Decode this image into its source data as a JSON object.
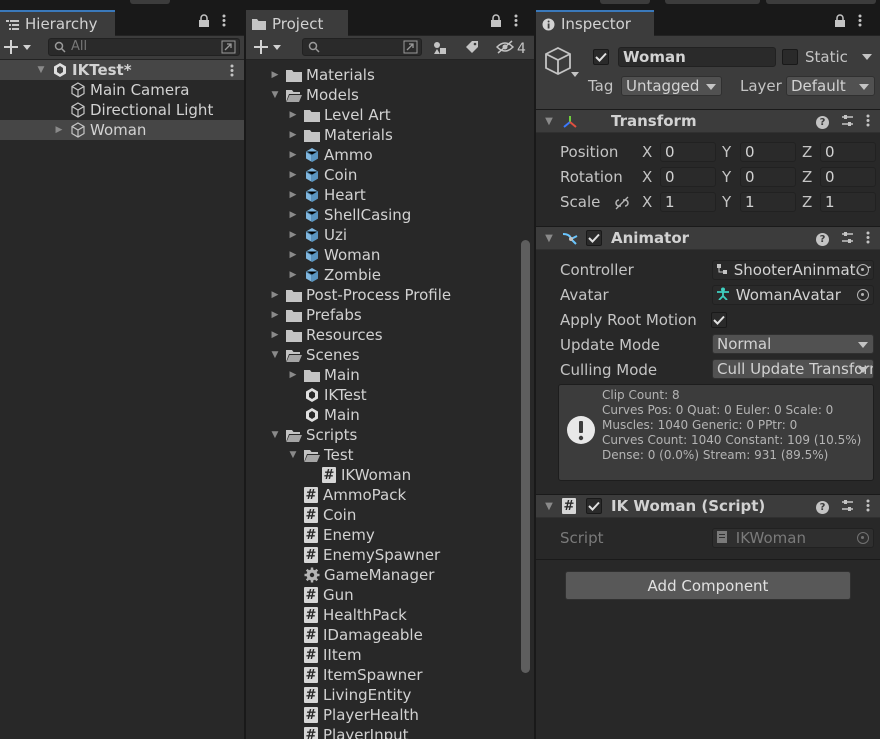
{
  "hierarchy": {
    "tab_label": "Hierarchy",
    "search_placeholder": "All",
    "scene_name": "IKTest*",
    "items": [
      {
        "label": "Main Camera"
      },
      {
        "label": "Directional Light"
      },
      {
        "label": "Woman"
      }
    ]
  },
  "project": {
    "tab_label": "Project",
    "hidden_count": "4",
    "tree": [
      {
        "label": "Materials",
        "kind": "folder"
      },
      {
        "label": "Models",
        "kind": "folder-open"
      },
      {
        "label": "Level Art",
        "kind": "folder"
      },
      {
        "label": "Materials",
        "kind": "folder"
      },
      {
        "label": "Ammo",
        "kind": "model"
      },
      {
        "label": "Coin",
        "kind": "model"
      },
      {
        "label": "Heart",
        "kind": "model"
      },
      {
        "label": "ShellCasing",
        "kind": "model"
      },
      {
        "label": "Uzi",
        "kind": "model"
      },
      {
        "label": "Woman",
        "kind": "model"
      },
      {
        "label": "Zombie",
        "kind": "model"
      },
      {
        "label": "Post-Process Profile",
        "kind": "folder"
      },
      {
        "label": "Prefabs",
        "kind": "folder"
      },
      {
        "label": "Resources",
        "kind": "folder"
      },
      {
        "label": "Scenes",
        "kind": "folder-open"
      },
      {
        "label": "Main",
        "kind": "folder"
      },
      {
        "label": "IKTest",
        "kind": "scene"
      },
      {
        "label": "Main",
        "kind": "scene"
      },
      {
        "label": "Scripts",
        "kind": "folder-open"
      },
      {
        "label": "Test",
        "kind": "folder-open"
      },
      {
        "label": "IKWoman",
        "kind": "script"
      },
      {
        "label": "AmmoPack",
        "kind": "script"
      },
      {
        "label": "Coin",
        "kind": "script"
      },
      {
        "label": "Enemy",
        "kind": "script"
      },
      {
        "label": "EnemySpawner",
        "kind": "script"
      },
      {
        "label": "GameManager",
        "kind": "gear"
      },
      {
        "label": "Gun",
        "kind": "script"
      },
      {
        "label": "HealthPack",
        "kind": "script"
      },
      {
        "label": "IDamageable",
        "kind": "script"
      },
      {
        "label": "IItem",
        "kind": "script"
      },
      {
        "label": "ItemSpawner",
        "kind": "script"
      },
      {
        "label": "LivingEntity",
        "kind": "script"
      },
      {
        "label": "PlayerHealth",
        "kind": "script"
      },
      {
        "label": "PlayerInput",
        "kind": "script"
      }
    ]
  },
  "inspector": {
    "tab_label": "Inspector",
    "object_name": "Woman",
    "static_label": "Static",
    "tag_label": "Tag",
    "tag_value": "Untagged",
    "layer_label": "Layer",
    "layer_value": "Default",
    "transform": {
      "title": "Transform",
      "position_label": "Position",
      "rotation_label": "Rotation",
      "scale_label": "Scale",
      "x": "X",
      "y": "Y",
      "z": "Z",
      "position": [
        "0",
        "0",
        "0"
      ],
      "rotation": [
        "0",
        "0",
        "0"
      ],
      "scale": [
        "1",
        "1",
        "1"
      ]
    },
    "animator": {
      "title": "Animator",
      "controller_label": "Controller",
      "controller_value": "ShooterAninmator",
      "avatar_label": "Avatar",
      "avatar_value": "WomanAvatar",
      "root_motion_label": "Apply Root Motion",
      "update_mode_label": "Update Mode",
      "update_mode_value": "Normal",
      "culling_mode_label": "Culling Mode",
      "culling_mode_value": "Cull Update Transforms",
      "info_lines": [
        "Clip Count: 8",
        "Curves Pos: 0 Quat: 0 Euler: 0 Scale: 0",
        "Muscles: 1040 Generic: 0 PPtr: 0",
        "Curves Count: 1040 Constant: 109 (10.5%)",
        "Dense: 0 (0.0%) Stream: 931 (89.5%)"
      ]
    },
    "script_component": {
      "title": "IK Woman (Script)",
      "script_label": "Script",
      "script_value": "IKWoman"
    },
    "add_component_label": "Add Component"
  },
  "colors": {
    "panel_bg": "#282828",
    "header_bg": "#3c3c3c",
    "selected_row": "#464646",
    "tab_accent": "#3a79bb",
    "folder": "#c4c4c4",
    "model_icon": "#7fb7e0"
  }
}
